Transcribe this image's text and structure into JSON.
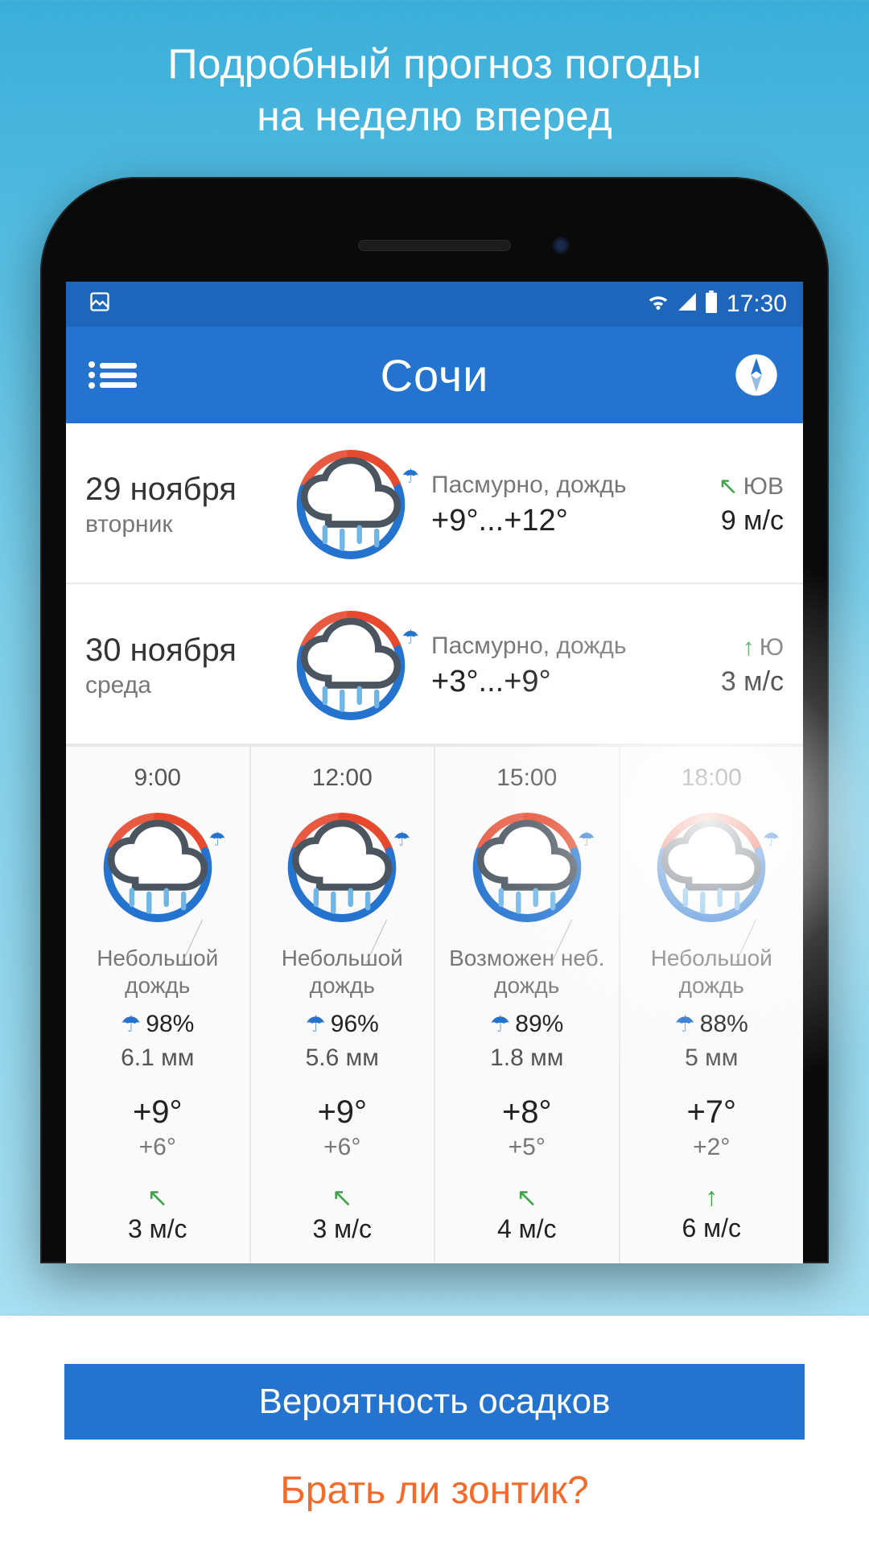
{
  "promo": {
    "line1": "Подробный прогноз погоды",
    "line2": "на неделю вперед"
  },
  "statusbar": {
    "time": "17:30"
  },
  "header": {
    "city": "Сочи"
  },
  "days": [
    {
      "date": "29 ноября",
      "weekday": "вторник",
      "condition": "Пасмурно, дождь",
      "temp_range": "+9°...+12°",
      "wind_arrow": "↖",
      "wind_dir": "ЮВ",
      "wind_speed": "9 м/с"
    },
    {
      "date": "30 ноября",
      "weekday": "среда",
      "condition": "Пасмурно, дождь",
      "temp_range": "+3°...+9°",
      "wind_arrow": "↑",
      "wind_dir": "Ю",
      "wind_speed": "3 м/с"
    }
  ],
  "hours": [
    {
      "time": "9:00",
      "condition": "Небольшой дождь",
      "precip_pct": "98%",
      "precip_mm": "6.1 мм",
      "temp_hi": "+9°",
      "temp_lo": "+6°",
      "wind_arrow": "↖",
      "wind_speed": "3 м/с"
    },
    {
      "time": "12:00",
      "condition": "Небольшой дождь",
      "precip_pct": "96%",
      "precip_mm": "5.6 мм",
      "temp_hi": "+9°",
      "temp_lo": "+6°",
      "wind_arrow": "↖",
      "wind_speed": "3 м/с"
    },
    {
      "time": "15:00",
      "condition": "Возможен неб. дождь",
      "precip_pct": "89%",
      "precip_mm": "1.8 мм",
      "temp_hi": "+8°",
      "temp_lo": "+5°",
      "wind_arrow": "↖",
      "wind_speed": "4 м/с"
    },
    {
      "time": "18:00",
      "condition": "Небольшой дождь",
      "precip_pct": "88%",
      "precip_mm": "5 мм",
      "temp_hi": "+7°",
      "temp_lo": "+2°",
      "wind_arrow": "↑",
      "wind_speed": "6 м/с"
    }
  ],
  "footer": {
    "blue_bar": "Вероятность осадков",
    "cta": "Брать ли зонтик?"
  }
}
